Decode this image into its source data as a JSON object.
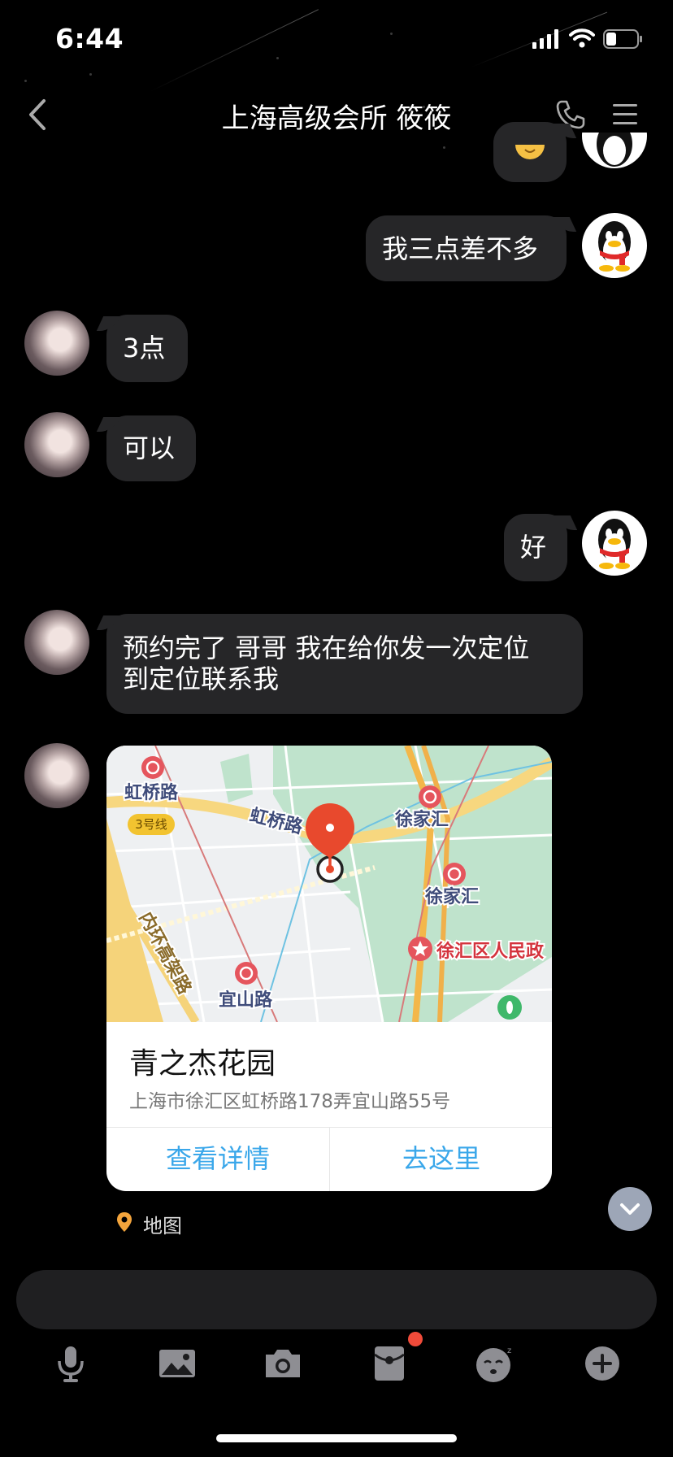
{
  "status_bar": {
    "time": "6:44"
  },
  "header": {
    "title": "上海高级会所 筱筱"
  },
  "messages": [
    {
      "side": "right",
      "text": "我三点差不多"
    },
    {
      "side": "left",
      "text": "3点"
    },
    {
      "side": "left",
      "text": "可以"
    },
    {
      "side": "right",
      "text": "好"
    },
    {
      "side": "left",
      "text": "预约完了 哥哥 我在给你发一次定位\n到定位联系我"
    }
  ],
  "location_card": {
    "name": "青之杰花园",
    "address": "上海市徐汇区虹桥路178弄宜山路55号",
    "detail_button": "查看详情",
    "go_button": "去这里",
    "map_labels": {
      "hongqiao_station": "虹桥路",
      "line3": "3号线",
      "hongqiao_road": "虹桥路",
      "xujiahui_1": "徐家汇",
      "xujiahui_2": "徐家汇",
      "gov": "徐汇区人民政",
      "ring": "内环高架路",
      "yishan": "宜山路"
    }
  },
  "map_tag": "地图",
  "colors": {
    "accent_blue": "#3aa7ea",
    "bubble": "#262628",
    "badge": "#f04b3a"
  },
  "icons": [
    "back-icon",
    "phone-icon",
    "menu-icon",
    "microphone-icon",
    "image-icon",
    "camera-icon",
    "red-packet-icon",
    "emoji-icon",
    "plus-icon",
    "chevron-down-icon",
    "location-pin-icon"
  ]
}
